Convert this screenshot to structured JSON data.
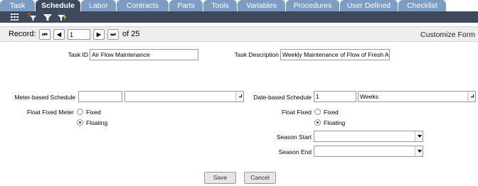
{
  "tabs": [
    {
      "label": "Task",
      "active": false
    },
    {
      "label": "Schedule",
      "active": true
    },
    {
      "label": "Labor",
      "active": false
    },
    {
      "label": "Contracts",
      "active": false
    },
    {
      "label": "Parts",
      "active": false
    },
    {
      "label": "Tools",
      "active": false
    },
    {
      "label": "Variables",
      "active": false
    },
    {
      "label": "Procedures",
      "active": false
    },
    {
      "label": "User Defined",
      "active": false
    },
    {
      "label": "Checklist",
      "active": false
    }
  ],
  "toolbar": {
    "icons": [
      "grid-icon",
      "clear-filter-icon",
      "filter-icon",
      "quick-filter-icon"
    ]
  },
  "record": {
    "label": "Record:",
    "current": "1",
    "of_text": "of 25",
    "first_glyph": "⏮",
    "prev_glyph": "◀",
    "next_glyph": "▶",
    "last_glyph": "⏭"
  },
  "customize_form": "Customize Form",
  "form": {
    "task_id_label": "Task ID",
    "task_id_value": "Air Flow Maintenance",
    "task_description_label": "Task Description",
    "task_description_value": "Weekly Maintenance of Flow of Fresh Ai",
    "meter_schedule_label": "Meter-based Schedule",
    "meter_value": "",
    "meter_unit": "",
    "date_schedule_label": "Date-based Schedule",
    "date_value": "1",
    "date_unit": "Weeks",
    "float_fixed_meter_label": "Float Fixed Meter",
    "float_fixed_label": "Float Fixed",
    "fixed_option": "Fixed",
    "floating_option": "Floating",
    "meter_float_selected": "Floating",
    "date_float_selected": "Floating",
    "season_start_label": "Season Start",
    "season_start_value": "",
    "season_end_label": "Season End",
    "season_end_value": ""
  },
  "buttons": {
    "save": "Save",
    "cancel": "Cancel"
  }
}
